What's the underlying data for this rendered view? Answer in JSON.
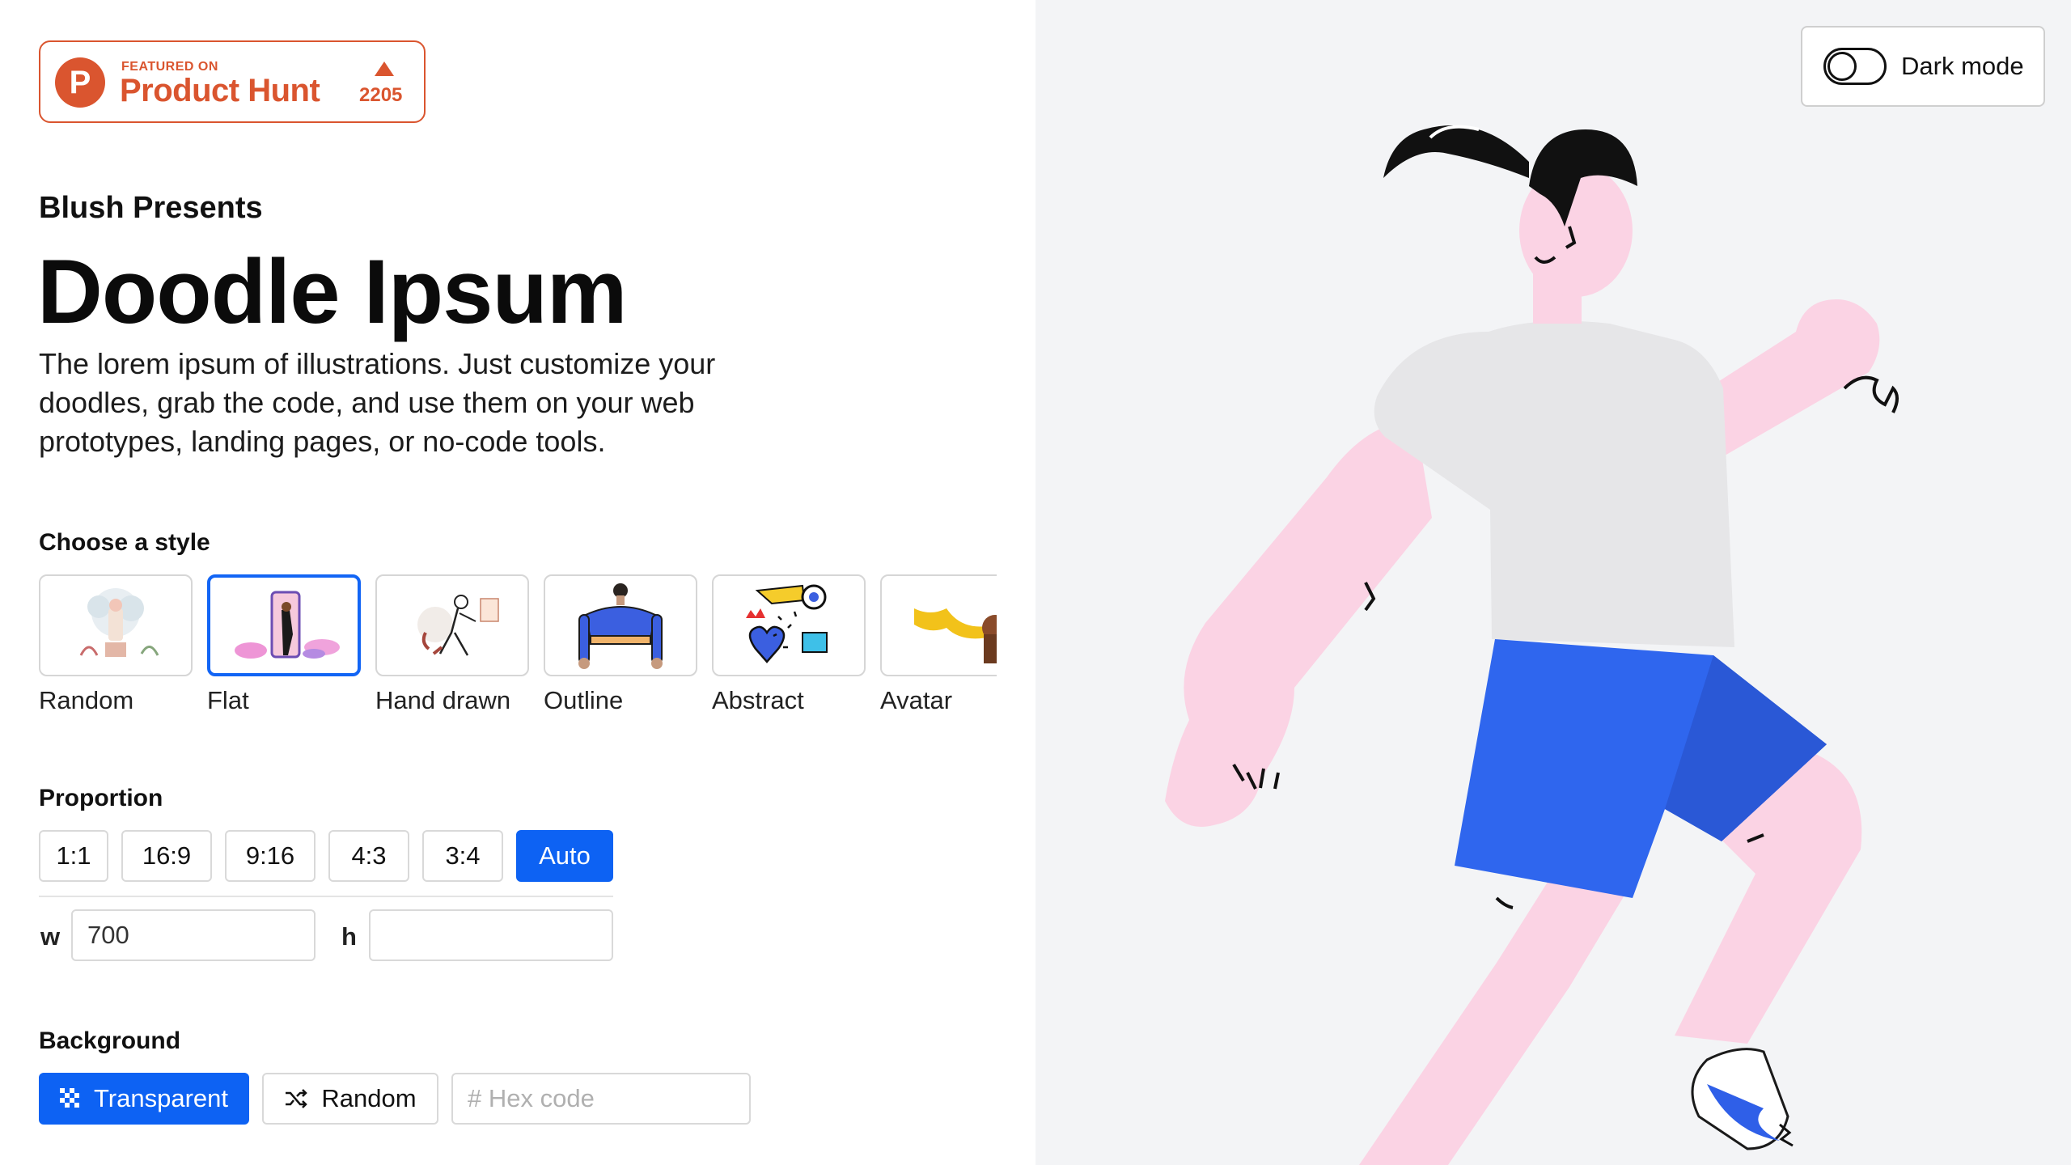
{
  "badge": {
    "featured_label": "FEATURED ON",
    "name": "Product Hunt",
    "logo_letter": "P",
    "upvotes": "2205",
    "color": "#da552f"
  },
  "header": {
    "presents": "Blush Presents",
    "title": "Doodle Ipsum",
    "description": "The lorem ipsum of illustrations. Just customize your doodles, grab the code, and use them on your web prototypes, landing pages, or no-code tools."
  },
  "styles": {
    "label": "Choose a style",
    "items": [
      {
        "label": "Random",
        "selected": false
      },
      {
        "label": "Flat",
        "selected": true
      },
      {
        "label": "Hand drawn",
        "selected": false
      },
      {
        "label": "Outline",
        "selected": false
      },
      {
        "label": "Abstract",
        "selected": false
      },
      {
        "label": "Avatar",
        "selected": false
      }
    ]
  },
  "proportion": {
    "label": "Proportion",
    "options": [
      "1:1",
      "16:9",
      "9:16",
      "4:3",
      "3:4",
      "Auto"
    ],
    "selected": "Auto",
    "width_label": "w",
    "width_value": "700",
    "height_label": "h",
    "height_value": ""
  },
  "background": {
    "label": "Background",
    "transparent_label": "Transparent",
    "random_label": "Random",
    "hex_placeholder": "# Hex code",
    "selected": "Transparent"
  },
  "dark_mode": {
    "label": "Dark mode",
    "enabled": false
  },
  "colors": {
    "accent": "#0d62f3",
    "preview_bg": "#f3f4f6"
  }
}
